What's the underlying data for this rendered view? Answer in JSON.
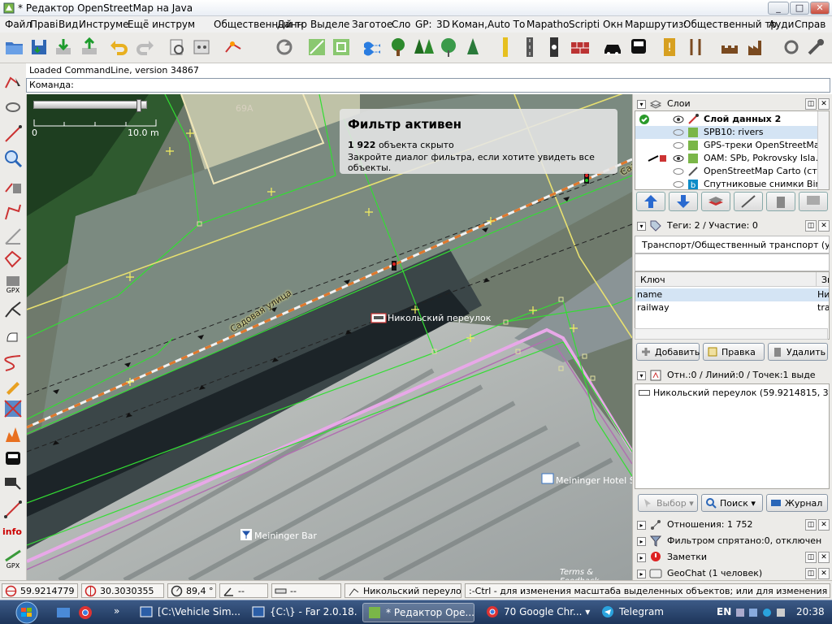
{
  "window": {
    "title": "* Редактор OpenStreetMap на Java",
    "min": "_",
    "max": "□",
    "close": "✕"
  },
  "menu": [
    "Файл",
    "Прaві",
    "Вид",
    "Инструме",
    "Ещё инструм",
    "Общественный тр",
    "Данн",
    "Выделе",
    "Заготое",
    "Сло",
    "GP:",
    "3D",
    "Коман,",
    "Auto То",
    "Mapatho",
    "Scripti",
    "Окн",
    "Маршрутиз:",
    "Общественный тр",
    "Ауди",
    "Справ"
  ],
  "command": {
    "loaded": "Loaded CommandLine, version 34867",
    "prompt": "Команда:"
  },
  "map": {
    "scale_left": "0",
    "scale_right": "10.0 m",
    "building_label": "69А",
    "filter_popup": {
      "title": "Фильтр активен",
      "count": "1 922",
      "count_suffix": " объекта скрыто",
      "hint": "Закройте диалог фильтра, если хотите увидеть все объекты."
    },
    "street": "Садовая улица",
    "street_right": "Садо",
    "lane_label": "Никольский переулок",
    "hotel_label": "Meininger Hotel Sa",
    "bar_label": "Meininger Bar",
    "terms": "Terms & Feedback"
  },
  "layers_panel": {
    "title": "Слои",
    "items": [
      {
        "name": "Слой данных 2",
        "bold": true
      },
      {
        "name": "SPB10: rivers",
        "selected": true
      },
      {
        "name": "GPS-треки OpenStreetMap"
      },
      {
        "name": "OAM: SPb, Pokrovsky Isla..."
      },
      {
        "name": "OpenStreetMap Carto (ст..."
      },
      {
        "name": "Спутниковые снимки Bing"
      }
    ]
  },
  "tags_panel": {
    "title": "Теги: 2 / Участие: 0",
    "preset": "Транспорт/Общественный транспорт (уст",
    "columns": [
      "Ключ",
      "Зн"
    ],
    "rows": [
      {
        "key": "name",
        "value": "Ни"
      },
      {
        "key": "railway",
        "value": "tra"
      }
    ],
    "buttons": {
      "add": "Добавить",
      "edit": "Правка",
      "delete": "Удалить"
    }
  },
  "selection_panel": {
    "title": "Отн.:0 / Линий:0 / Точек:1 выде",
    "item": "Никольский переулок (59.9214815, 30.303",
    "buttons": {
      "select": "Выбор",
      "search": "Поиск",
      "history": "Журнал"
    }
  },
  "collapsed_panels": [
    {
      "name": "Отношения: 1 752"
    },
    {
      "name": "Фильтром спрятано:0, отключен"
    },
    {
      "name": "Заметки"
    },
    {
      "name": "GeoChat (1 человек)"
    }
  ],
  "status": {
    "lat": "59.9214779",
    "lon": "30.3030355",
    "angle": "89,4 °",
    "heading": "--",
    "distance": "--",
    "object": "Никольский переулок ...",
    "hint": ":-Ctrl - для изменения масштаба выделенных объектов; или для изменения выделения"
  },
  "taskbar": {
    "items": [
      {
        "label": "[C:\\Vehicle Sim..."
      },
      {
        "label": "{C:\\} - Far 2.0.18..."
      },
      {
        "label": "* Редактор Ope...",
        "active": true
      },
      {
        "label": "70 Google Chr..."
      },
      {
        "label": "Telegram"
      }
    ],
    "lang": "EN",
    "clock": "20:38"
  },
  "colors": {
    "accent": "#3a75c4",
    "filter_bg": "#e6e6e6",
    "street_line": "#e0782c",
    "polygon_green": "#33dd33",
    "building_pink": "#e0a0e0"
  }
}
